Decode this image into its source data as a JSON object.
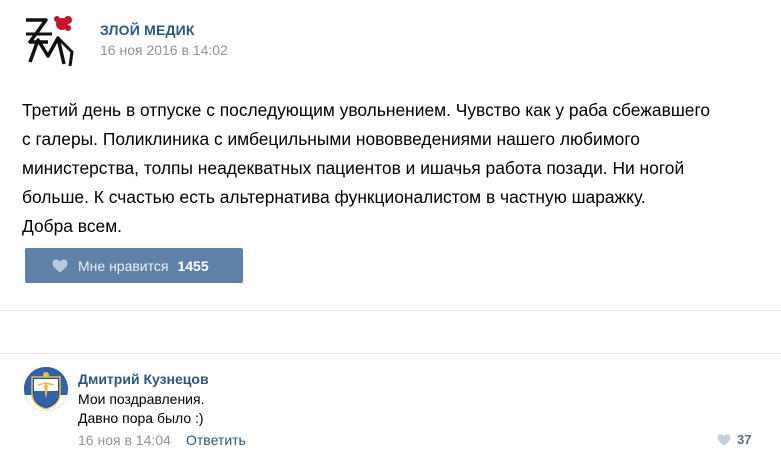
{
  "post": {
    "author": "ЗЛОЙ МЕДИК",
    "logo_icon": "zm-logo-icon",
    "date": "16 ноя 2016 в 14:02",
    "text": "Третий день в отпуске с последующим увольнением. Чувство как у раба сбежавшего\nс галеры. Поликлиника с имбецильными нововведениями нашего любимого\nминистерства, толпы неадекватных пациентов и ишачья работа позади. Ни ногой\nбольше. К счастью есть альтернатива функционалистом в частную шаражку.\nДобра всем.",
    "like_label": "Мне нравится",
    "like_count": "1455"
  },
  "comment": {
    "author": "Дмитрий Кузнецов",
    "avatar_icon": "coat-of-arms-avatar-icon",
    "text": "Мои поздравления.\nДавно пора было :)",
    "date": "16 ноя в 14:04",
    "reply_label": "Ответить",
    "like_count": "37"
  },
  "colors": {
    "link": "#2a5885",
    "muted": "#939393",
    "like_button": "#5f81a8",
    "divider": "#e7e8ec"
  }
}
